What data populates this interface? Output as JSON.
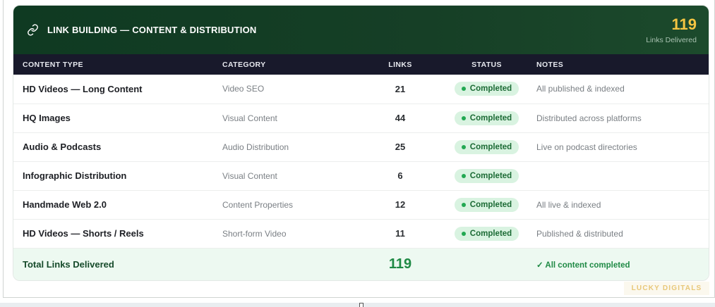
{
  "header": {
    "title": "LINK BUILDING — CONTENT & DISTRIBUTION",
    "count": "119",
    "count_label": "Links Delivered"
  },
  "columns": [
    "CONTENT TYPE",
    "CATEGORY",
    "LINKS",
    "STATUS",
    "NOTES"
  ],
  "rows": [
    {
      "type": "HD Videos — Long Content",
      "category": "Video SEO",
      "links": "21",
      "status": "Completed",
      "notes": "All published & indexed"
    },
    {
      "type": "HQ Images",
      "category": "Visual Content",
      "links": "44",
      "status": "Completed",
      "notes": "Distributed across platforms"
    },
    {
      "type": "Audio & Podcasts",
      "category": "Audio Distribution",
      "links": "25",
      "status": "Completed",
      "notes": "Live on podcast directories"
    },
    {
      "type": "Infographic Distribution",
      "category": "Visual Content",
      "links": "6",
      "status": "Completed",
      "notes": ""
    },
    {
      "type": "Handmade Web 2.0",
      "category": "Content Properties",
      "links": "12",
      "status": "Completed",
      "notes": "All live & indexed"
    },
    {
      "type": "HD Videos — Shorts / Reels",
      "category": "Short-form Video",
      "links": "11",
      "status": "Completed",
      "notes": "Published & distributed"
    }
  ],
  "footer": {
    "label": "Total Links Delivered",
    "total": "119",
    "note": "✓ All content completed"
  },
  "watermark": "LUCKY DIGITALS",
  "colors": {
    "header_bg": "#163f26",
    "accent_gold": "#f4c542",
    "table_head_bg": "#18192b",
    "badge_bg": "#d9f3e1",
    "badge_text": "#1c6b35",
    "total_green": "#1f8a45"
  },
  "icons": {
    "header": "link-icon",
    "status": "status-dot-icon"
  }
}
